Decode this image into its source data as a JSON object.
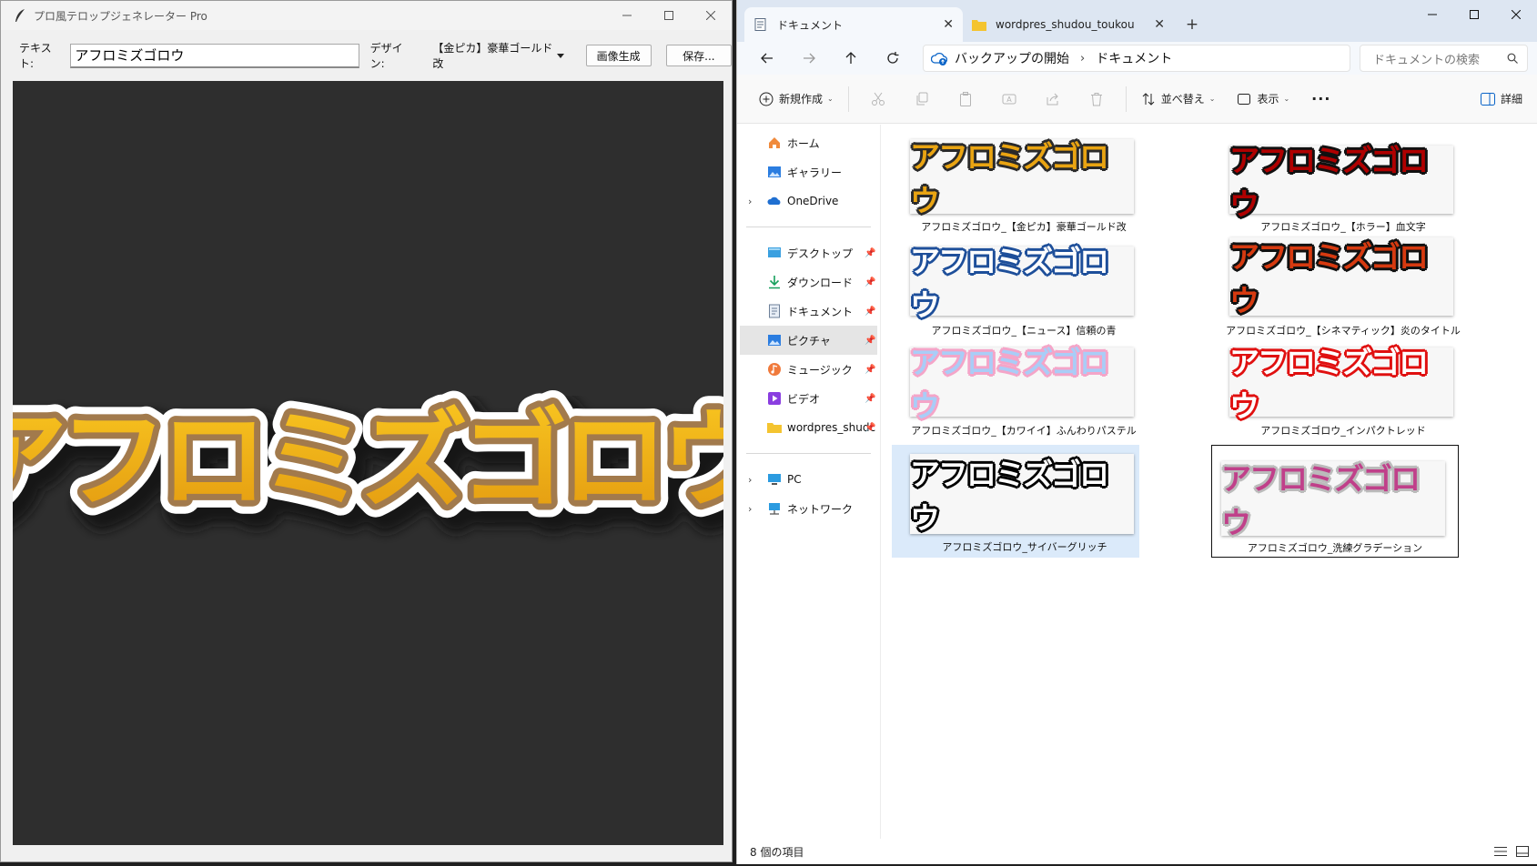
{
  "app": {
    "title": "プロ風テロップジェネレーター Pro",
    "text_label": "テキスト:",
    "text_value": "アフロミズゴロウ",
    "design_label": "デザイン:",
    "design_value": "【金ピカ】豪華ゴールド改",
    "generate_label": "画像生成",
    "save_label": "保存...",
    "preview_text": "アフロミズゴロウ",
    "preview_colors": {
      "fill_top": "#f8c520",
      "fill_bottom": "#e39a10",
      "inner_stroke": "#a27a4c",
      "outer_stroke": "#ffffff",
      "shadow": "#151515",
      "canvas_bg": "#2e2e2e"
    }
  },
  "explorer": {
    "tabs": [
      {
        "label": "ドキュメント",
        "active": true
      },
      {
        "label": "wordpres_shudou_toukou",
        "active": false
      }
    ],
    "breadcrumb": [
      "バックアップの開始",
      "ドキュメント"
    ],
    "search_placeholder": "ドキュメントの検索",
    "commands": {
      "new": "新規作成",
      "sort": "並べ替え",
      "view": "表示",
      "details": "詳細"
    },
    "sidebar": {
      "top": [
        {
          "label": "ホーム",
          "icon": "home-icon",
          "expand": false
        },
        {
          "label": "ギャラリー",
          "icon": "gallery-icon",
          "expand": false
        },
        {
          "label": "OneDrive",
          "icon": "cloud-icon",
          "expand": true
        }
      ],
      "pinned": [
        {
          "label": "デスクトップ",
          "icon": "desktop-icon"
        },
        {
          "label": "ダウンロード",
          "icon": "download-icon"
        },
        {
          "label": "ドキュメント",
          "icon": "document-icon"
        },
        {
          "label": "ピクチャ",
          "icon": "pictures-icon",
          "selected": true
        },
        {
          "label": "ミュージック",
          "icon": "music-icon"
        },
        {
          "label": "ビデオ",
          "icon": "video-icon"
        },
        {
          "label": "wordpres_shudc",
          "icon": "folder-icon"
        }
      ],
      "bottom": [
        {
          "label": "PC",
          "icon": "pc-icon",
          "expand": true
        },
        {
          "label": "ネットワーク",
          "icon": "network-icon",
          "expand": true
        }
      ]
    },
    "files": [
      {
        "name": "アフロミズゴロウ_【金ピカ】豪華ゴールド改",
        "thumb_text": "アフロミズゴロウ",
        "fill": "#e9a412",
        "stroke": "#2a2a2a",
        "bg": "#f7f7f7"
      },
      {
        "name": "アフロミズゴロウ_【ホラー】血文字",
        "thumb_text": "アフロミズゴロウ",
        "fill": "#b00000",
        "stroke": "#111111",
        "bg": "#f7f7f7"
      },
      {
        "name": "アフロミズゴロウ_【ニュース】信頼の青",
        "thumb_text": "アフロミズゴロウ",
        "fill": "#ffffff",
        "stroke": "#1e4f9a",
        "bg": "#f7f7f7"
      },
      {
        "name": "アフロミズゴロウ_【シネマティック】炎のタイトル",
        "thumb_text": "アフロミズゴロウ",
        "fill": "#d63a10",
        "stroke": "#111111",
        "bg": "#f7f7f7"
      },
      {
        "name": "アフロミズゴロウ_【カワイイ】ふんわりパステル",
        "thumb_text": "アフロミズゴロウ",
        "fill": "#a9cdf7",
        "stroke": "#f4a5c8",
        "bg": "#f7f7f7"
      },
      {
        "name": "アフロミズゴロウ_インパクトレッド",
        "thumb_text": "アフロミズゴロウ",
        "fill": "#ffffff",
        "stroke": "#e01010",
        "bg": "#f7f7f7"
      },
      {
        "name": "アフロミズゴロウ_サイバーグリッチ",
        "thumb_text": "アフロミズゴロウ",
        "fill": "#ffffff",
        "stroke": "#000000",
        "bg": "#f7f7f7"
      },
      {
        "name": "アフロミズゴロウ_洗練グラデーション",
        "thumb_text": "アフロミズゴロウ",
        "fill": "#c0408a",
        "stroke": "#bbbbbb",
        "bg": "#f7f7f7"
      }
    ],
    "status": "8 個の項目"
  }
}
